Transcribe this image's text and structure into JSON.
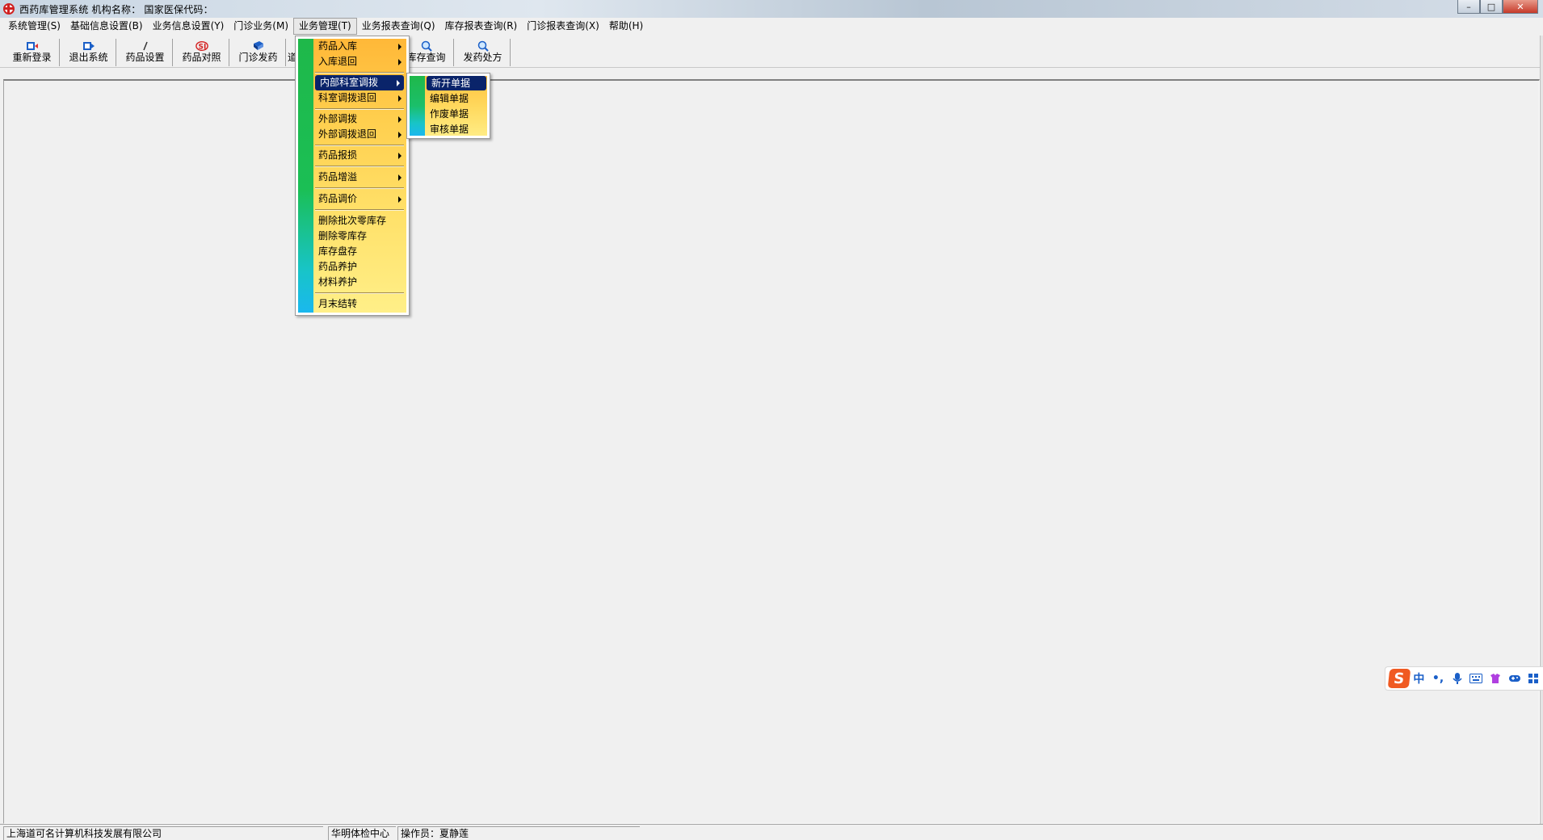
{
  "window": {
    "title": "西药库管理系统   机构名称：  国家医保代码：",
    "minimize_glyph": "–",
    "maximize_glyph": "□",
    "close_glyph": "✕"
  },
  "menubar": {
    "items": [
      {
        "label": "系统管理(S)"
      },
      {
        "label": "基础信息设置(B)"
      },
      {
        "label": "业务信息设置(Y)"
      },
      {
        "label": "门诊业务(M)"
      },
      {
        "label": "业务管理(T)"
      },
      {
        "label": "业务报表查询(Q)"
      },
      {
        "label": "库存报表查询(R)"
      },
      {
        "label": "门诊报表查询(X)"
      },
      {
        "label": "帮助(H)"
      }
    ]
  },
  "toolbar": {
    "buttons": [
      {
        "label": "重新登录",
        "icon": "relogin-icon"
      },
      {
        "label": "退出系统",
        "icon": "exit-icon"
      },
      {
        "label": "药品设置",
        "icon": "pencil-icon"
      },
      {
        "label": "药品对照",
        "icon": "si-icon"
      },
      {
        "label": "门诊发药",
        "icon": "book-icon"
      },
      {
        "label": "道",
        "icon": ""
      },
      {
        "label": "库存查询",
        "icon": "magnifier-icon"
      },
      {
        "label": "发药处方",
        "icon": "magnifier-icon"
      }
    ]
  },
  "dropdown": {
    "items": [
      {
        "label": "药品入库",
        "submenu": true
      },
      {
        "label": "入库退回",
        "submenu": true
      },
      {
        "label": "内部科室调拨",
        "submenu": true,
        "highlighted": true
      },
      {
        "label": "科室调拨退回",
        "submenu": true
      },
      {
        "label": "外部调拨",
        "submenu": true
      },
      {
        "label": "外部调拨退回",
        "submenu": true
      },
      {
        "label": "药品报损",
        "submenu": true
      },
      {
        "label": "药品增溢",
        "submenu": true
      },
      {
        "label": "药品调价",
        "submenu": true
      },
      {
        "label": "删除批次零库存"
      },
      {
        "label": "删除零库存"
      },
      {
        "label": "库存盘存"
      },
      {
        "label": "药品养护"
      },
      {
        "label": "材料养护"
      },
      {
        "label": "月末结转"
      }
    ]
  },
  "submenu": {
    "items": [
      {
        "label": "新开单据",
        "highlighted": true
      },
      {
        "label": "编辑单据"
      },
      {
        "label": "作废单据"
      },
      {
        "label": "审核单据"
      }
    ]
  },
  "ime": {
    "logo": "S",
    "mode": "中",
    "punct": "•,",
    "items": [
      "mic-icon",
      "keyboard-icon",
      "skin-icon",
      "game-icon",
      "grid-icon"
    ]
  },
  "statusbar": {
    "company": "上海道可名计算机科技发展有限公司",
    "center": "华明体检中心",
    "operator": "操作员：夏静莲"
  },
  "colors": {
    "menu_highlight": "#0a246a",
    "menu_gradient_top": "#ffb838",
    "menu_gradient_bottom": "#ffef88",
    "strip_green": "#1fb84a",
    "strip_cyan": "#1ab8ee"
  }
}
